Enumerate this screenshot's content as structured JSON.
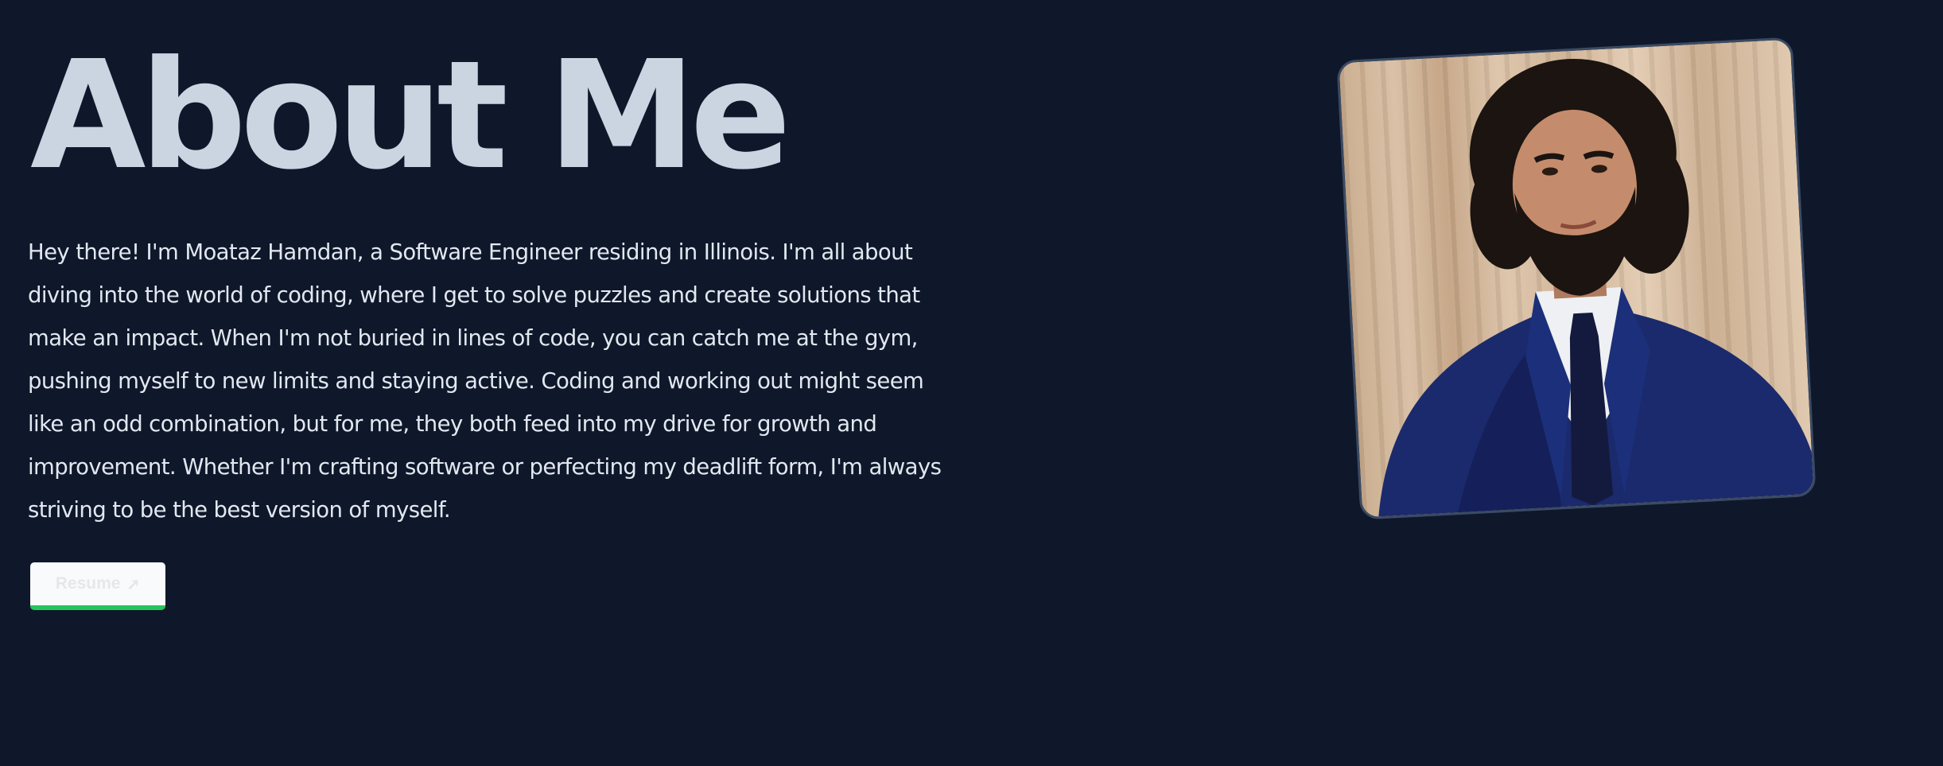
{
  "about": {
    "heading": "About Me",
    "bio": "Hey there! I'm Moataz Hamdan, a Software Engineer residing in Illinois. I'm all about diving into the world of coding, where I get to solve puzzles and create solutions that make an impact. When I'm not buried in lines of code, you can catch me at the gym, pushing myself to new limits and staying active. Coding and working out might seem like an odd combination, but for me, they both feed into my drive for growth and improvement. Whether I'm crafting software or perfecting my deadlift form, I'm always striving to be the best version of myself.",
    "resume_label": "Resume",
    "resume_icon": "arrow-up-right-icon"
  },
  "colors": {
    "background": "#0f172a",
    "heading": "#cbd5e1",
    "text": "#e2e8f0",
    "button_bg": "#f8fafc",
    "button_accent": "#22c55e"
  },
  "photo": {
    "description": "portrait-photo"
  }
}
